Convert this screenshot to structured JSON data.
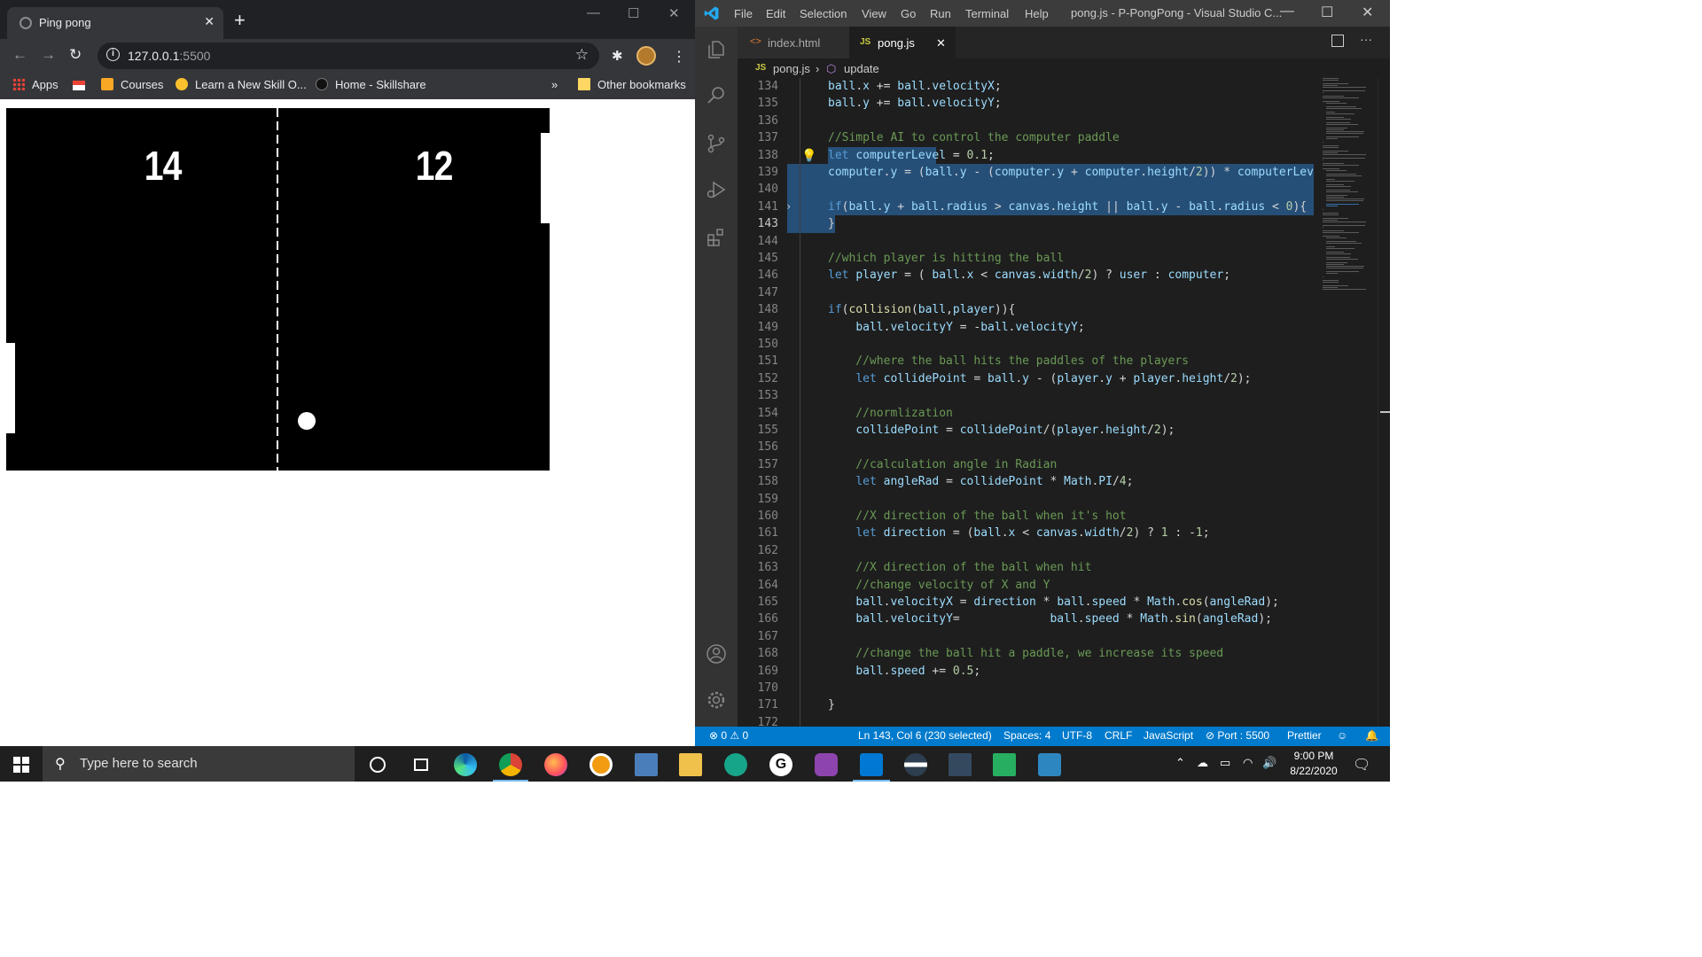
{
  "chrome": {
    "tab_title": "Ping pong",
    "tab_close": "✕",
    "new_tab": "+",
    "url_host": "127.0.0.1",
    "url_port": ":5500",
    "bookmarks": [
      {
        "label": "Apps"
      },
      {
        "label": "Courses"
      },
      {
        "label": "Learn a New Skill O..."
      },
      {
        "label": "Home - Skillshare"
      }
    ],
    "bookmarks_more": "»",
    "other_bookmarks": "Other bookmarks"
  },
  "game": {
    "score_left": "14",
    "score_right": "12"
  },
  "vscode": {
    "menu": [
      "File",
      "Edit",
      "Selection",
      "View",
      "Go",
      "Run",
      "Terminal",
      "Help"
    ],
    "window_title": "pong.js - P-PongPong - Visual Studio C...",
    "tabs": [
      {
        "label": "index.html",
        "icon": "<>"
      },
      {
        "label": "pong.js",
        "icon": "JS"
      }
    ],
    "tab_close": "✕",
    "breadcrumb": {
      "file": "pong.js",
      "symbol": "update",
      "file_icon": "JS"
    },
    "status": {
      "errors": "0",
      "warnings": "0",
      "position": "Ln 143, Col 6 (230 selected)",
      "spaces": "Spaces: 4",
      "encoding": "UTF-8",
      "eol": "CRLF",
      "language": "JavaScript",
      "port": "Port : 5500",
      "formatter": "Prettier"
    },
    "code_lines": [
      {
        "n": "134",
        "text": "ball.x += ball.velocityX;"
      },
      {
        "n": "135",
        "text": "ball.y += ball.velocityY;"
      },
      {
        "n": "136",
        "text": ""
      },
      {
        "n": "137",
        "text": "//Simple AI to control the computer paddle"
      },
      {
        "n": "138",
        "text": "let computerLevel = 0.1;"
      },
      {
        "n": "139",
        "text": "computer.y = (ball.y - (computer.y + computer.height/2)) * computerLev"
      },
      {
        "n": "140",
        "text": ""
      },
      {
        "n": "141",
        "text": "if(ball.y + ball.radius > canvas.height || ball.y - ball.radius < 0){"
      },
      {
        "n": "143",
        "text": "}"
      },
      {
        "n": "144",
        "text": ""
      },
      {
        "n": "145",
        "text": "//which player is hitting the ball"
      },
      {
        "n": "146",
        "text": "let player = ( ball.x < canvas.width/2) ? user : computer;"
      },
      {
        "n": "147",
        "text": ""
      },
      {
        "n": "148",
        "text": "if(collision(ball,player)){"
      },
      {
        "n": "149",
        "text": "    ball.velocityY = -ball.velocityY;"
      },
      {
        "n": "150",
        "text": ""
      },
      {
        "n": "151",
        "text": "    //where the ball hits the paddles of the players"
      },
      {
        "n": "152",
        "text": "    let collidePoint = ball.y - (player.y + player.height/2);"
      },
      {
        "n": "153",
        "text": ""
      },
      {
        "n": "154",
        "text": "    //normlization"
      },
      {
        "n": "155",
        "text": "    collidePoint = collidePoint/(player.height/2);"
      },
      {
        "n": "156",
        "text": ""
      },
      {
        "n": "157",
        "text": "    //calculation angle in Radian"
      },
      {
        "n": "158",
        "text": "    let angleRad = collidePoint * Math.PI/4;"
      },
      {
        "n": "159",
        "text": ""
      },
      {
        "n": "160",
        "text": "    //X direction of the ball when it's hot"
      },
      {
        "n": "161",
        "text": "    let direction = (ball.x < canvas.width/2) ? 1 : -1;"
      },
      {
        "n": "162",
        "text": ""
      },
      {
        "n": "163",
        "text": "    //X direction of the ball when hit"
      },
      {
        "n": "164",
        "text": "    //change velocity of X and Y"
      },
      {
        "n": "165",
        "text": "    ball.velocityX = direction * ball.speed * Math.cos(angleRad);"
      },
      {
        "n": "166",
        "text": "    ball.velocityY=             ball.speed * Math.sin(angleRad);"
      },
      {
        "n": "167",
        "text": ""
      },
      {
        "n": "168",
        "text": "    //change the ball hit a paddle, we increase its speed"
      },
      {
        "n": "169",
        "text": "    ball.speed += 0.5;"
      },
      {
        "n": "170",
        "text": ""
      },
      {
        "n": "171",
        "text": "}"
      },
      {
        "n": "172",
        "text": ""
      }
    ]
  },
  "taskbar": {
    "search_placeholder": "Type here to search",
    "time": "9:00 PM",
    "date": "8/22/2020"
  },
  "colors": {
    "vscode_accent": "#007acc",
    "selection": "#264f78"
  }
}
